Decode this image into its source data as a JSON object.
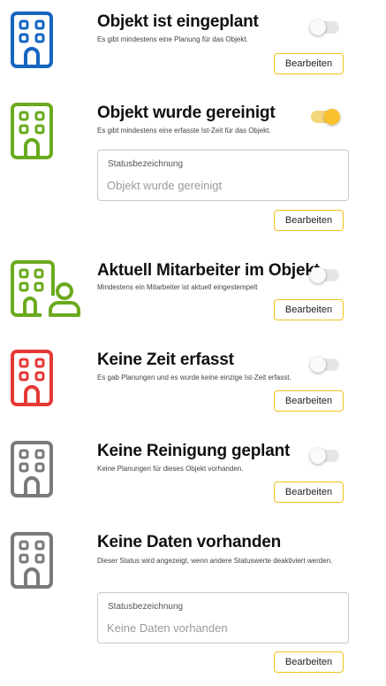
{
  "statuses": [
    {
      "title": "Objekt ist eingeplant",
      "description": "Es gibt mindestens eine Planung für das Objekt.",
      "icon": "building-icon",
      "color": "#1565c0",
      "enabled": false,
      "edit_label": "Bearbeiten"
    },
    {
      "title": "Objekt wurde gereinigt",
      "description": "Es gibt mindestens eine erfasste Ist-Zeit für das Objekt.",
      "icon": "building-icon",
      "color": "#6aaa1e",
      "enabled": true,
      "field_label": "Statusbezeichnung",
      "field_placeholder": "Objekt wurde gereinigt",
      "edit_label": "Bearbeiten"
    },
    {
      "title": "Aktuell Mitarbeiter im Objekt",
      "description": "Mindestens ein Mitarbeiter ist aktuell eingestempelt",
      "icon": "building-person-icon",
      "color": "#6aaa1e",
      "enabled": false,
      "edit_label": "Bearbeiten"
    },
    {
      "title": "Keine Zeit erfasst",
      "description": "Es gab Planungen und es wurde keine einzige Ist-Zeit erfasst.",
      "icon": "building-icon",
      "color": "#e53935",
      "enabled": false,
      "edit_label": "Bearbeiten"
    },
    {
      "title": "Keine Reinigung geplant",
      "description": "Keine Planungen für dieses Objekt vorhanden.",
      "icon": "building-icon",
      "color": "#7a7a7a",
      "enabled": false,
      "edit_label": "Bearbeiten"
    },
    {
      "title": "Keine Daten vorhanden",
      "description": "Dieser Status wird angezeigt, wenn andere Statuswerte deaktiviert werden.",
      "icon": "building-icon",
      "color": "#7a7a7a",
      "enabled": false,
      "field_label": "Statusbezeichnung",
      "field_placeholder": "Keine Daten vorhanden",
      "edit_label": "Bearbeiten"
    }
  ]
}
